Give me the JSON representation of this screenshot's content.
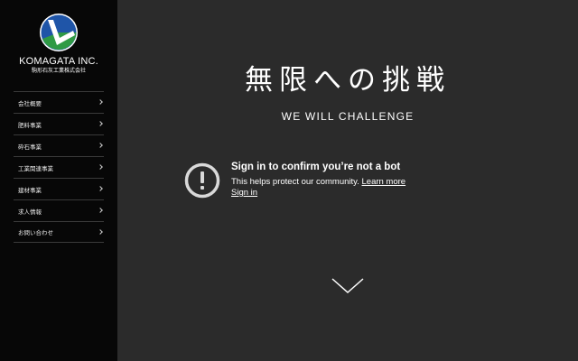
{
  "sidebar": {
    "logo": {
      "name": "KOMAGATA INC.",
      "sub": "駒形石灰工業株式会社"
    },
    "items": [
      {
        "label": "会社概要"
      },
      {
        "label": "肥料事業"
      },
      {
        "label": "砕石事業"
      },
      {
        "label": "工業関連事業"
      },
      {
        "label": "建材事業"
      },
      {
        "label": "求人情報"
      },
      {
        "label": "お問い合わせ"
      }
    ]
  },
  "hero": {
    "title": "無限への挑戦",
    "subtitle": "WE WILL CHALLENGE"
  },
  "notice": {
    "icon": "exclamation-circle-icon",
    "title": "Sign in to confirm you’re not a bot",
    "text": "This helps protect our community.",
    "learn_more": "Learn more",
    "sign_in": "Sign in"
  },
  "colors": {
    "sidebar_bg": "#070707",
    "main_bg": "#2b2b2b",
    "logo_blue": "#1f55a8",
    "logo_green": "#2f9a45"
  }
}
